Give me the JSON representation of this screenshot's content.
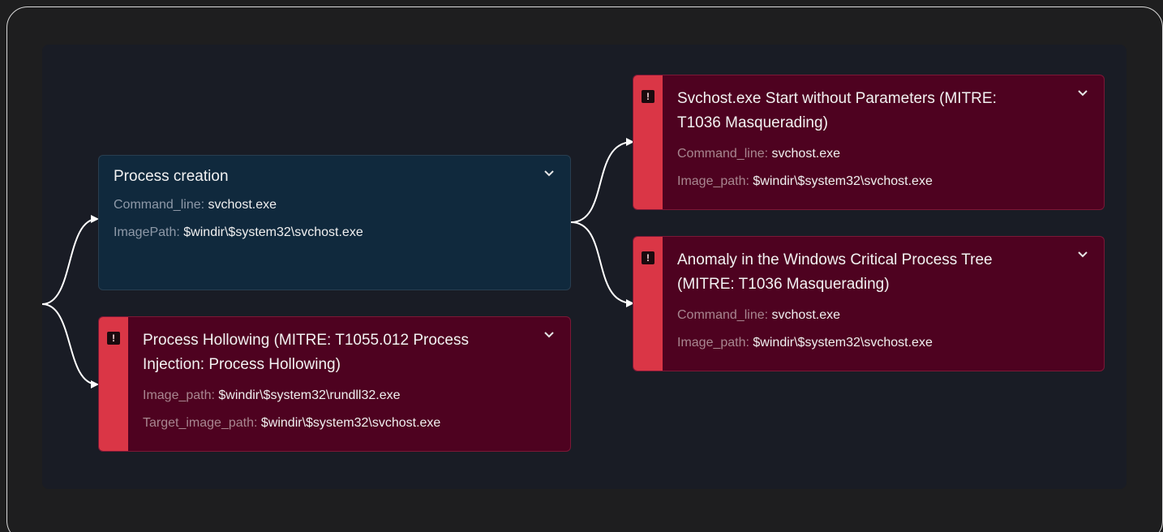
{
  "cards": {
    "process_creation": {
      "title": "Process creation",
      "fields": [
        {
          "key": "Command_line:",
          "value": "svchost.exe"
        },
        {
          "key": "ImagePath:",
          "value": "$windir\\$system32\\svchost.exe"
        }
      ]
    },
    "process_hollowing": {
      "title": "Process Hollowing (MITRE: T1055.012 Process Injection: Process Hollowing)",
      "title_line1": "Process Hollowing (MITRE: T1055.012 Process",
      "title_line2": "Injection: Process Hollowing)",
      "fields": [
        {
          "key": "Image_path:",
          "value": "$windir\\$system32\\rundll32.exe"
        },
        {
          "key": "Target_image_path:",
          "value": "$windir\\$system32\\svchost.exe"
        }
      ]
    },
    "svchost_start": {
      "title_line1": "Svchost.exe Start without Parameters (MITRE:",
      "title_line2": "T1036 Masquerading)",
      "fields": [
        {
          "key": "Command_line:",
          "value": "svchost.exe"
        },
        {
          "key": "Image_path:",
          "value": "$windir\\$system32\\svchost.exe"
        }
      ]
    },
    "anomaly_tree": {
      "title_line1": "Anomaly in the Windows Critical Process Tree",
      "title_line2": "(MITRE: T1036 Masquerading)",
      "fields": [
        {
          "key": "Command_line:",
          "value": "svchost.exe"
        },
        {
          "key": "Image_path:",
          "value": "$windir\\$system32\\svchost.exe"
        }
      ]
    }
  },
  "icons": {
    "alert": "exclamation-icon",
    "expand": "chevron-down-icon"
  },
  "colors": {
    "event_card_bg": "#10293d",
    "alert_card_bg": "#4e0220",
    "alert_stripe": "#da3646",
    "canvas_bg": "#191c25",
    "connector": "#ffffff"
  }
}
